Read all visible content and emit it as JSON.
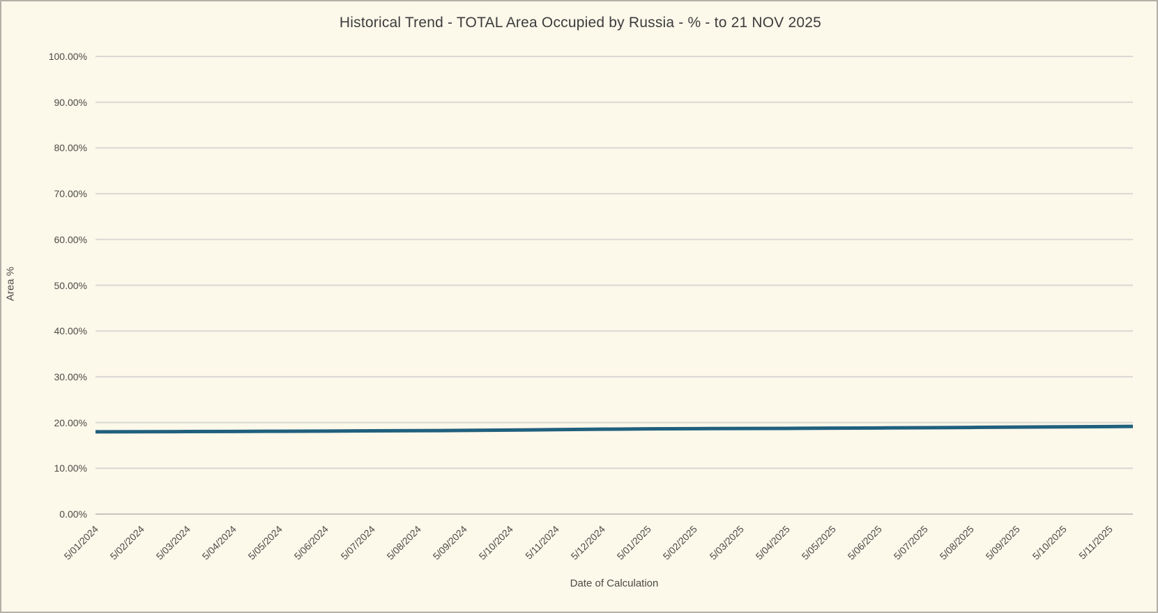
{
  "chart_data": {
    "type": "line",
    "title": "Historical Trend - TOTAL Area Occupied by Russia - % - to 21 NOV 2025",
    "xlabel": "Date of Calculation",
    "ylabel": "Area %",
    "ylim": [
      0,
      100
    ],
    "ytick_step": 10,
    "ytick_labels": [
      "0.00%",
      "10.00%",
      "20.00%",
      "30.00%",
      "40.00%",
      "50.00%",
      "60.00%",
      "70.00%",
      "80.00%",
      "90.00%",
      "100.00%"
    ],
    "grid": true,
    "legend": "none",
    "background_color": "#fcf8ea",
    "grid_color": "#d9d8d3",
    "axis_color": "#c6c5c0",
    "line_color": "#20607e",
    "text_color": "#4b4a46",
    "categories": [
      "5/01/2024",
      "5/02/2024",
      "5/03/2024",
      "5/04/2024",
      "5/05/2024",
      "5/06/2024",
      "5/07/2024",
      "5/08/2024",
      "5/09/2024",
      "5/10/2024",
      "5/11/2024",
      "5/12/2024",
      "5/01/2025",
      "5/02/2025",
      "5/03/2025",
      "5/04/2025",
      "5/05/2025",
      "5/06/2025",
      "5/07/2025",
      "5/08/2025",
      "5/09/2025",
      "5/10/2025",
      "5/11/2025"
    ],
    "series": [
      {
        "name": "TOTAL Area Occupied by Russia (%)",
        "values": [
          17.97,
          18.0,
          18.03,
          18.06,
          18.1,
          18.14,
          18.18,
          18.22,
          18.28,
          18.36,
          18.46,
          18.55,
          18.62,
          18.67,
          18.7,
          18.73,
          18.77,
          18.82,
          18.88,
          18.94,
          19.0,
          19.06,
          19.12
        ]
      }
    ],
    "end_point": {
      "date": "21 NOV 2025",
      "value": 19.15
    }
  }
}
